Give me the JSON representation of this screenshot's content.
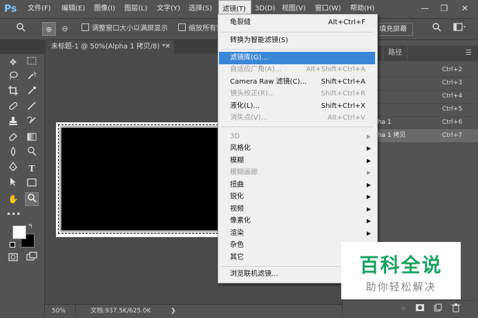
{
  "app": {
    "logo": "Ps"
  },
  "menubar": {
    "items": [
      "文件(F)",
      "编辑(E)",
      "图像(I)",
      "图层(L)",
      "文字(Y)",
      "选择(S)",
      "滤镜(T)",
      "3D(D)",
      "视图(V)",
      "窗口(W)",
      "帮助(H)"
    ],
    "window_controls": {
      "minimize": "—",
      "restore": "❐",
      "close": "✕"
    }
  },
  "options": {
    "zoom_in": "⊕",
    "zoom_out": "⊖",
    "check1": "调整窗口大小以满屏显示",
    "check2": "缩放所有窗",
    "fill_screen": "填充屏幕"
  },
  "document": {
    "tab_title": "未标题-1 @ 50%(Alpha 1 拷贝/8) *",
    "tab_close": "✕"
  },
  "status": {
    "zoom": "50%",
    "doc_info": "文档:937.5K/625.0K",
    "arrow": "❯"
  },
  "panel": {
    "tab_paths": "路径",
    "rows": [
      {
        "name": "B",
        "key": "Ctrl+2"
      },
      {
        "name": "",
        "key": "Ctrl+3"
      },
      {
        "name": "",
        "key": "Ctrl+4"
      },
      {
        "name": "",
        "key": "Ctrl+5"
      },
      {
        "name": "pha 1",
        "key": "Ctrl+6"
      },
      {
        "name": "pha 1 拷贝",
        "key": "Ctrl+7"
      }
    ]
  },
  "filter_menu": {
    "items": [
      {
        "label": "龟裂缝",
        "key": "Alt+Ctrl+F",
        "state": "normal"
      },
      {
        "label": "转换为智能滤镜(S)",
        "key": "",
        "state": "normal"
      },
      {
        "label": "滤镜库(G)...",
        "key": "",
        "state": "highlight"
      },
      {
        "label": "自适应广角(A)...",
        "key": "Alt+Shift+Ctrl+A",
        "state": "disabled"
      },
      {
        "label": "Camera Raw 滤镜(C)...",
        "key": "Shift+Ctrl+A",
        "state": "normal"
      },
      {
        "label": "镜头校正(R)...",
        "key": "Shift+Ctrl+R",
        "state": "disabled"
      },
      {
        "label": "液化(L)...",
        "key": "Shift+Ctrl+X",
        "state": "normal"
      },
      {
        "label": "消失点(V)...",
        "key": "Alt+Ctrl+V",
        "state": "disabled"
      },
      {
        "label": "3D",
        "state": "disabled",
        "sub": true
      },
      {
        "label": "风格化",
        "state": "normal",
        "sub": true
      },
      {
        "label": "模糊",
        "state": "normal",
        "sub": true
      },
      {
        "label": "模糊画廊",
        "state": "disabled",
        "sub": true
      },
      {
        "label": "扭曲",
        "state": "normal",
        "sub": true
      },
      {
        "label": "锐化",
        "state": "normal",
        "sub": true
      },
      {
        "label": "视频",
        "state": "normal",
        "sub": true
      },
      {
        "label": "像素化",
        "state": "normal",
        "sub": true
      },
      {
        "label": "渲染",
        "state": "normal",
        "sub": true
      },
      {
        "label": "杂色",
        "state": "normal",
        "sub": true
      },
      {
        "label": "其它",
        "state": "normal",
        "sub": true
      },
      {
        "label": "浏览联机滤镜...",
        "key": "",
        "state": "normal"
      }
    ],
    "submenu_arrow": "▶"
  },
  "watermark": {
    "title": "百科全说",
    "subtitle": "助你轻松解决"
  }
}
